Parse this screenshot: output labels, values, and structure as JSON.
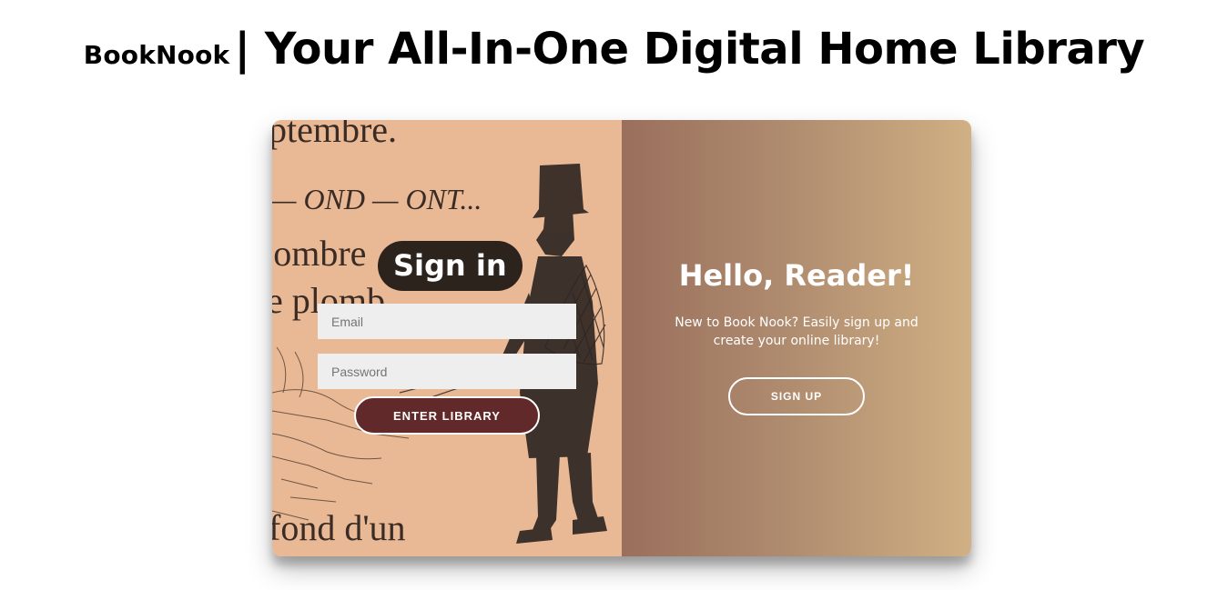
{
  "header": {
    "brand": "BookNook",
    "tagline": "| Your All-In-One Digital Home Library"
  },
  "signin": {
    "title": "Sign in",
    "email_placeholder": "Email",
    "password_placeholder": "Password",
    "submit_label": "ENTER LIBRARY",
    "background_text": [
      "ptembre.",
      "— OND — ONT...",
      "'ombre",
      "e plomb",
      "fond d'un"
    ]
  },
  "greeting": {
    "title": "Hello, Reader!",
    "message": "New to Book Nook? Easily sign up and create your online library!",
    "signup_label": "SIGN UP"
  },
  "colors": {
    "accent": "#62292b",
    "panel_gradient_start": "#9a6f5c",
    "panel_gradient_end": "#d0b084",
    "parchment": "#e9b996"
  }
}
